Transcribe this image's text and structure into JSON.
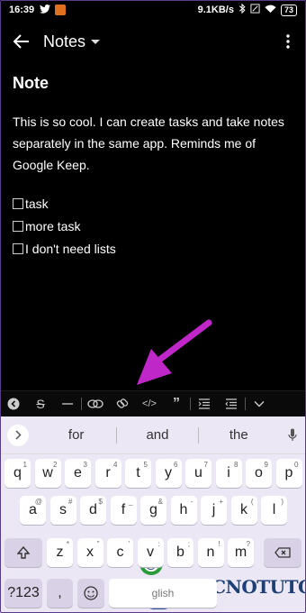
{
  "status_bar": {
    "time": "16:39",
    "speed": "9.1KB/s",
    "battery": "73"
  },
  "app_bar": {
    "title": "Notes"
  },
  "note": {
    "title": "Note",
    "body": "This is so cool. I can create tasks and take notes separately in the same app. Reminds me of Google Keep.",
    "tasks": [
      "task",
      "more task",
      "I don't need lists"
    ]
  },
  "toolbar": {
    "icons": [
      "backspace-circle-icon",
      "strikethrough-icon",
      "horizontal-rule-icon",
      "link-chain-icon",
      "link-icon",
      "code-icon",
      "quote-icon",
      "indent-icon",
      "outdent-icon",
      "chevron-down-icon"
    ],
    "strike_label": "S",
    "code_label": "</>",
    "quote_label": "”"
  },
  "keyboard": {
    "suggestions": [
      "for",
      "and",
      "the"
    ],
    "row1": [
      "q",
      "w",
      "e",
      "r",
      "t",
      "y",
      "u",
      "i",
      "o",
      "p"
    ],
    "row1_sup": [
      "1",
      "2",
      "3",
      "4",
      "5",
      "6",
      "7",
      "8",
      "9",
      "0"
    ],
    "row2": [
      "a",
      "s",
      "d",
      "f",
      "g",
      "h",
      "j",
      "k",
      "l"
    ],
    "row2_sup": [
      "@",
      "#",
      "$",
      "_",
      "&",
      "-",
      "+",
      "(",
      ")"
    ],
    "row3": [
      "z",
      "x",
      "c",
      "v",
      "b",
      "n",
      "m"
    ],
    "row3_sup": [
      "*",
      "\"",
      "'",
      ":",
      ";",
      "!",
      "?"
    ],
    "symbols_label": "?123",
    "comma_label": ",",
    "space_label": "glish",
    "accent_colors": {
      "arrow": "#c027c9",
      "logo_text": "#1e3f73"
    }
  },
  "watermark": {
    "text": "TECNOTUTO"
  }
}
